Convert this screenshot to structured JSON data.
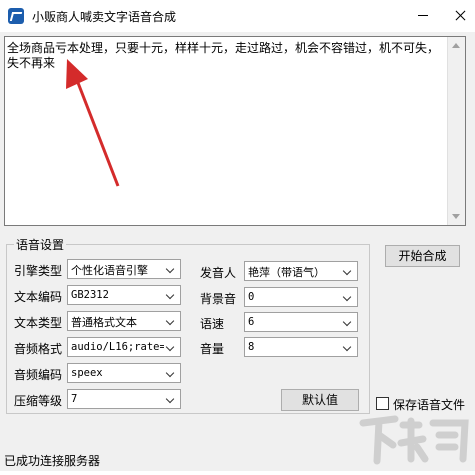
{
  "window": {
    "title": "小贩商人喊卖文字语音合成"
  },
  "editor": {
    "text": "全场商品亏本处理，只要十元，样样十元，走过路过，机会不容错过，机不可失，失不再来"
  },
  "settings": {
    "group_title": "语音设置",
    "engine_type": {
      "label": "引擎类型",
      "value": "个性化语音引擎"
    },
    "text_encoding": {
      "label": "文本编码",
      "value": "GB2312"
    },
    "text_type": {
      "label": "文本类型",
      "value": "普通格式文本"
    },
    "audio_format": {
      "label": "音频格式",
      "value": "audio/L16;rate="
    },
    "audio_encoding": {
      "label": "音频编码",
      "value": "speex"
    },
    "compression_level": {
      "label": "压缩等级",
      "value": "7"
    },
    "speaker": {
      "label": "发音人",
      "value": "艳萍（带语气）"
    },
    "background_sound": {
      "label": "背景音",
      "value": "0"
    },
    "speed": {
      "label": "语速",
      "value": "6"
    },
    "volume": {
      "label": "音量",
      "value": "8"
    },
    "default_button": "默认值"
  },
  "actions": {
    "start_button": "开始合成",
    "save_audio_label": "保存语音文件",
    "save_audio_checked": false
  },
  "status": {
    "text": "已成功连接服务器"
  },
  "colors": {
    "annotation_arrow": "#d42b2b"
  },
  "watermark": {
    "text": "下载吧"
  }
}
